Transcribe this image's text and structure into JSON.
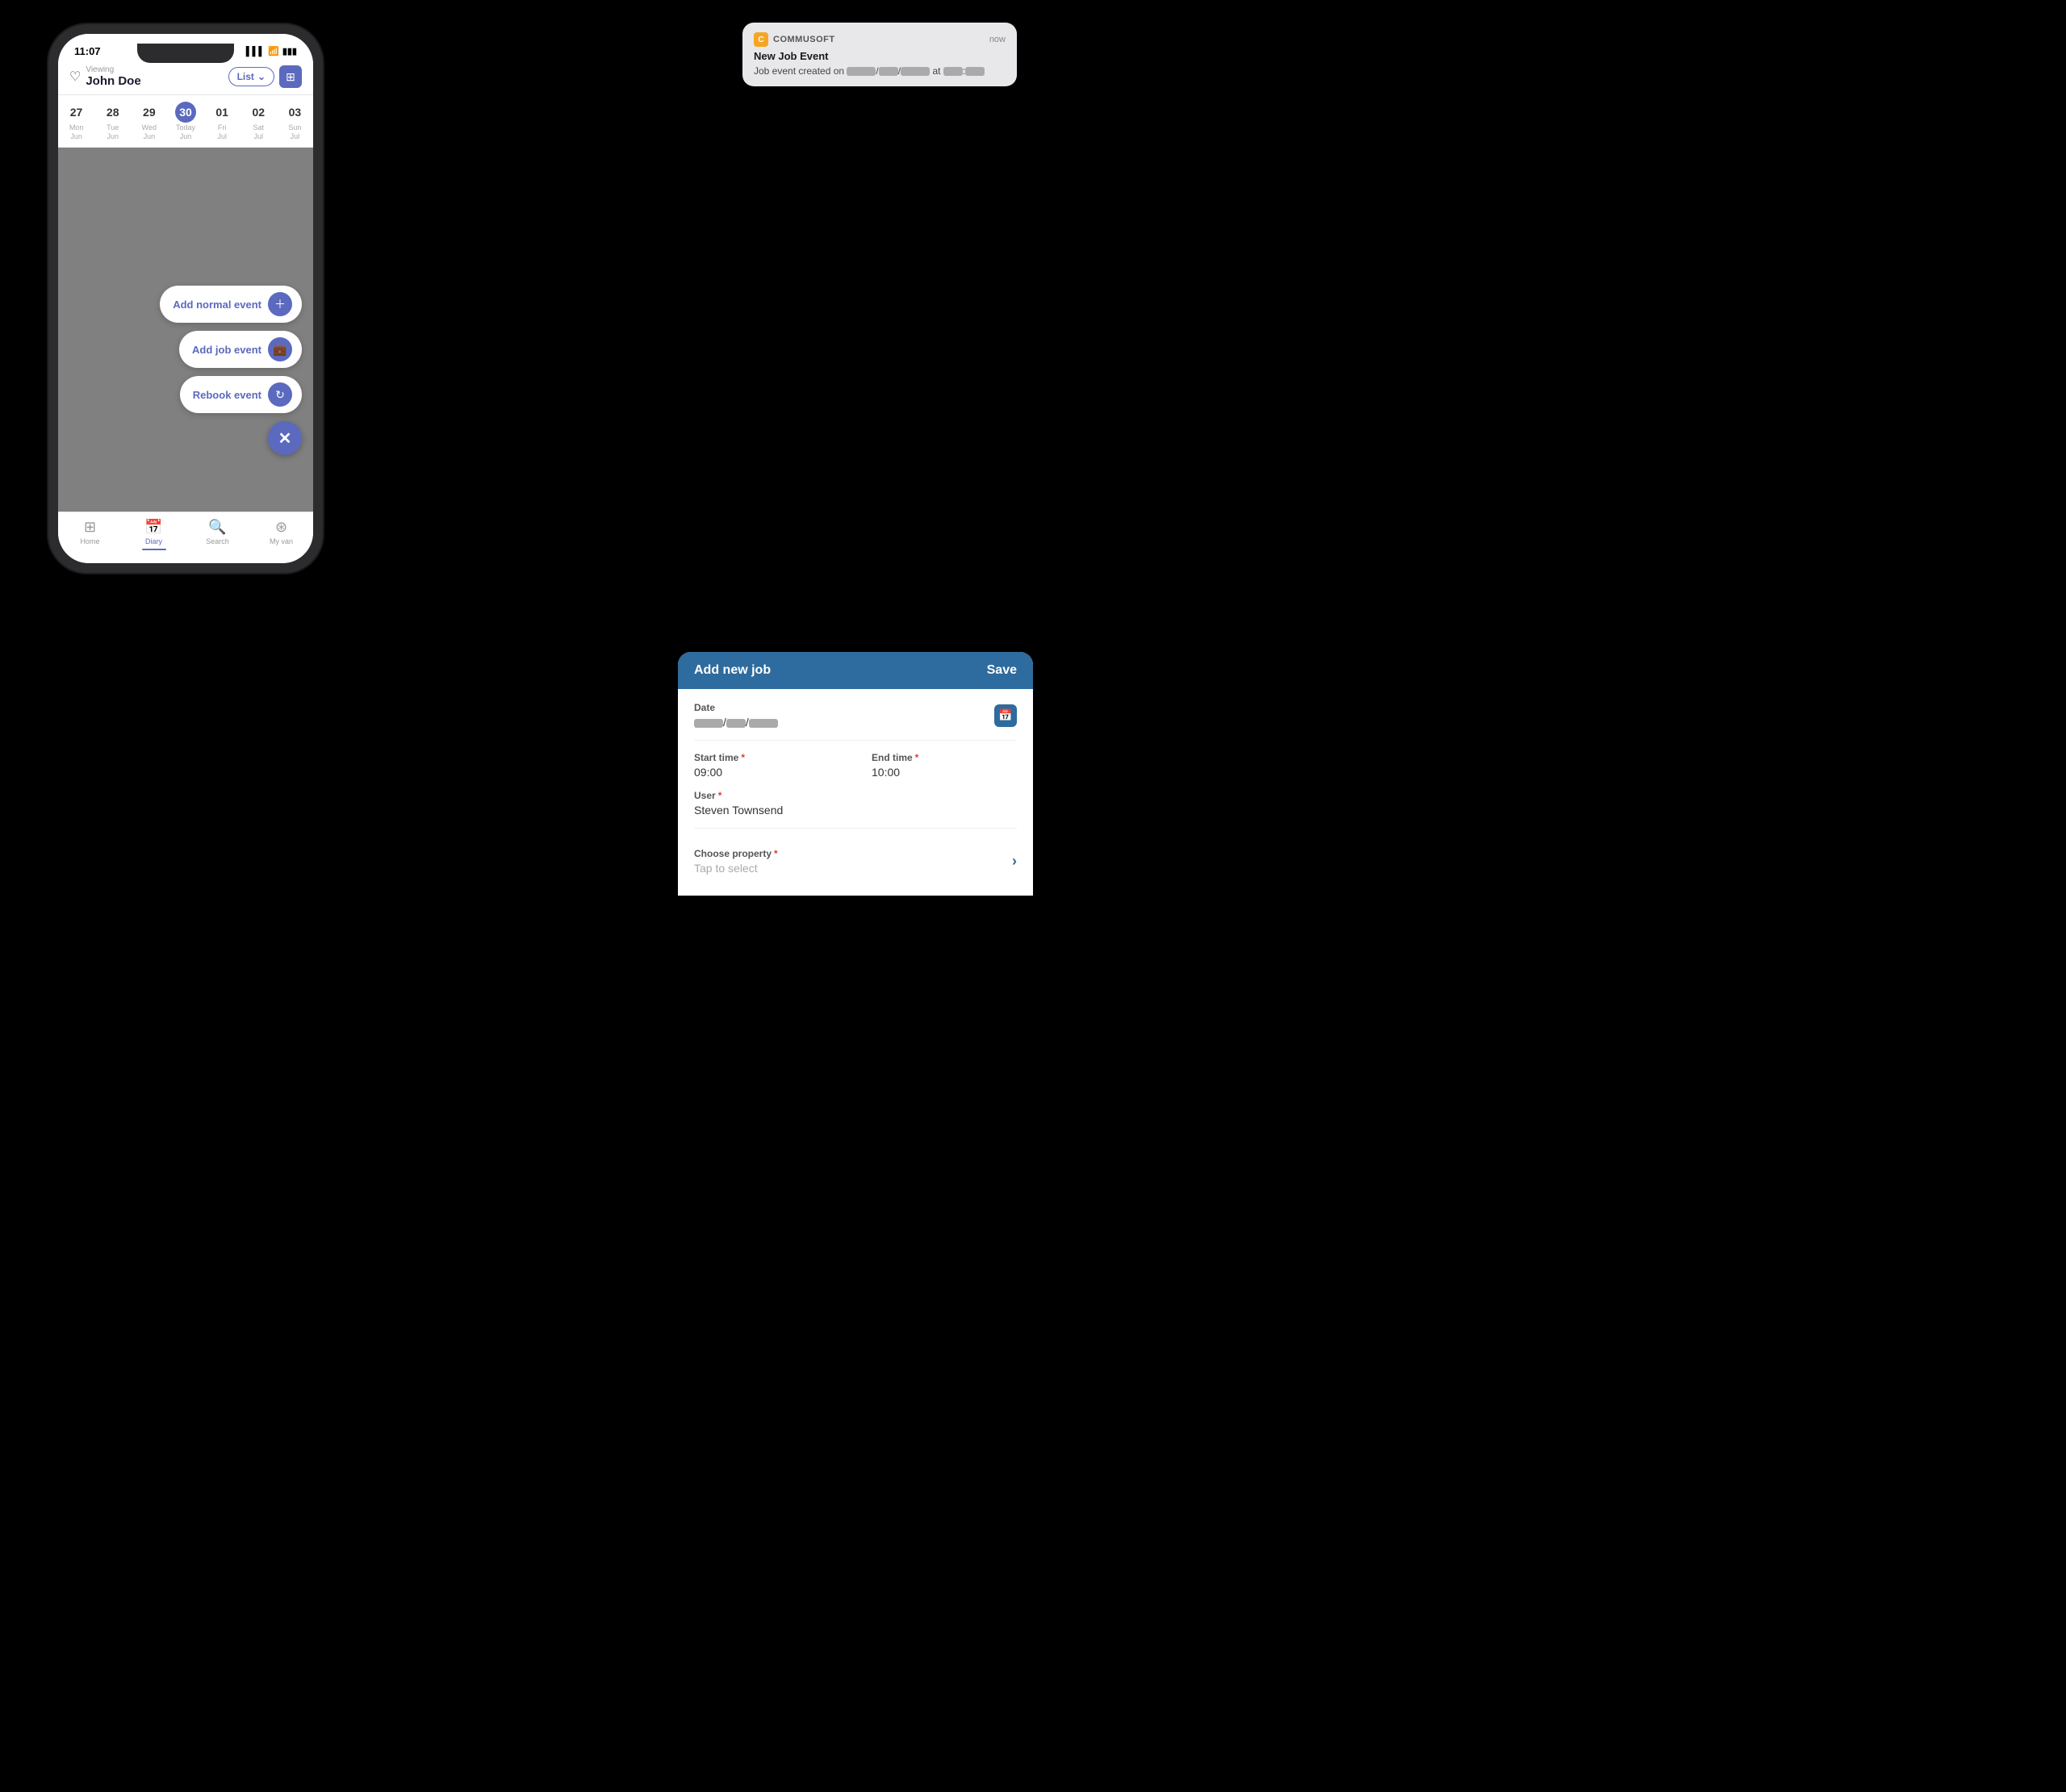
{
  "statusBar": {
    "time": "11:07",
    "signal": "▌▌▌",
    "wifi": "WiFi",
    "battery": "🔋"
  },
  "header": {
    "viewing_label": "Viewing",
    "user_name": "John Doe",
    "list_btn": "List",
    "chevron": "⌄"
  },
  "calendar": {
    "days": [
      {
        "num": "27",
        "label": "Mon",
        "month": "Jun",
        "today": false
      },
      {
        "num": "28",
        "label": "Tue",
        "month": "Jun",
        "today": false
      },
      {
        "num": "29",
        "label": "Wed",
        "month": "Jun",
        "today": false
      },
      {
        "num": "30",
        "label": "Today",
        "month": "Jun",
        "today": true
      },
      {
        "num": "01",
        "label": "Fri",
        "month": "Jul",
        "today": false
      },
      {
        "num": "02",
        "label": "Sat",
        "month": "Jul",
        "today": false
      },
      {
        "num": "03",
        "label": "Sun",
        "month": "Jul",
        "today": false
      }
    ]
  },
  "fab": {
    "add_normal_label": "Add normal event",
    "add_job_label": "Add job event",
    "rebook_label": "Rebook event",
    "close_icon": "✕"
  },
  "bottomNav": {
    "items": [
      {
        "icon": "⊞",
        "label": "Home",
        "active": false
      },
      {
        "icon": "📅",
        "label": "Diary",
        "active": true
      },
      {
        "icon": "🔍",
        "label": "Search",
        "active": false
      },
      {
        "icon": "⊛",
        "label": "My van",
        "active": false
      }
    ]
  },
  "notification": {
    "app_name": "COMMUSOFT",
    "time": "now",
    "title": "New Job Event",
    "body_prefix": "Job event created on",
    "at": "at"
  },
  "modal": {
    "title": "Add new job",
    "save_label": "Save",
    "date_label": "Date",
    "cal_icon": "📅",
    "start_time_label": "Start time",
    "start_time_req": "*",
    "start_time_value": "09:00",
    "end_time_label": "End time",
    "end_time_req": "*",
    "end_time_value": "10:00",
    "user_label": "User",
    "user_req": "*",
    "user_value": "Steven Townsend",
    "property_label": "Choose property",
    "property_req": "*",
    "property_placeholder": "Tap to select"
  }
}
